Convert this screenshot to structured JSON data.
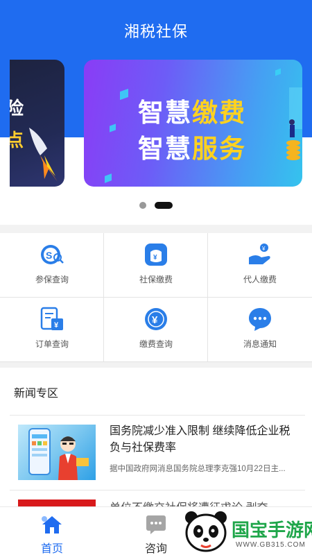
{
  "app": {
    "title": "湘税社保"
  },
  "banner": {
    "left_partial_line1": "险",
    "left_partial_line2": "点",
    "main_line1_white": "智慧",
    "main_line1_yellow": "缴费",
    "main_line2_white": "智慧",
    "main_line2_yellow": "服务"
  },
  "grid": {
    "items": [
      {
        "label": "参保查询",
        "icon": "insurance-search-icon"
      },
      {
        "label": "社保缴费",
        "icon": "payment-bag-icon"
      },
      {
        "label": "代人缴费",
        "icon": "hand-coin-icon"
      },
      {
        "label": "订单查询",
        "icon": "order-receipt-icon"
      },
      {
        "label": "缴费查询",
        "icon": "yen-circle-icon"
      },
      {
        "label": "消息通知",
        "icon": "message-bubble-icon"
      }
    ]
  },
  "news": {
    "section_title": "新闻专区",
    "items": [
      {
        "headline": "国务院减少准入限制 继续降低企业税负与社保费率",
        "summary": "据中国政府网消息国务院总理李克强10月22日主..."
      },
      {
        "headline": "单位不缴交社保将遭征求论 剥夺"
      }
    ]
  },
  "tabbar": {
    "items": [
      {
        "label": "首页",
        "icon": "home-icon",
        "active": true
      },
      {
        "label": "咨询",
        "icon": "chat-icon",
        "active": false
      }
    ]
  },
  "watermark": {
    "text": "国宝手游网",
    "url": "WWW.GB315.COM"
  },
  "colors": {
    "primary": "#1f6cf0",
    "accent_yellow": "#ffd21f",
    "active_tab": "#1f6cf0",
    "inactive_tab": "#9a9a9a"
  }
}
